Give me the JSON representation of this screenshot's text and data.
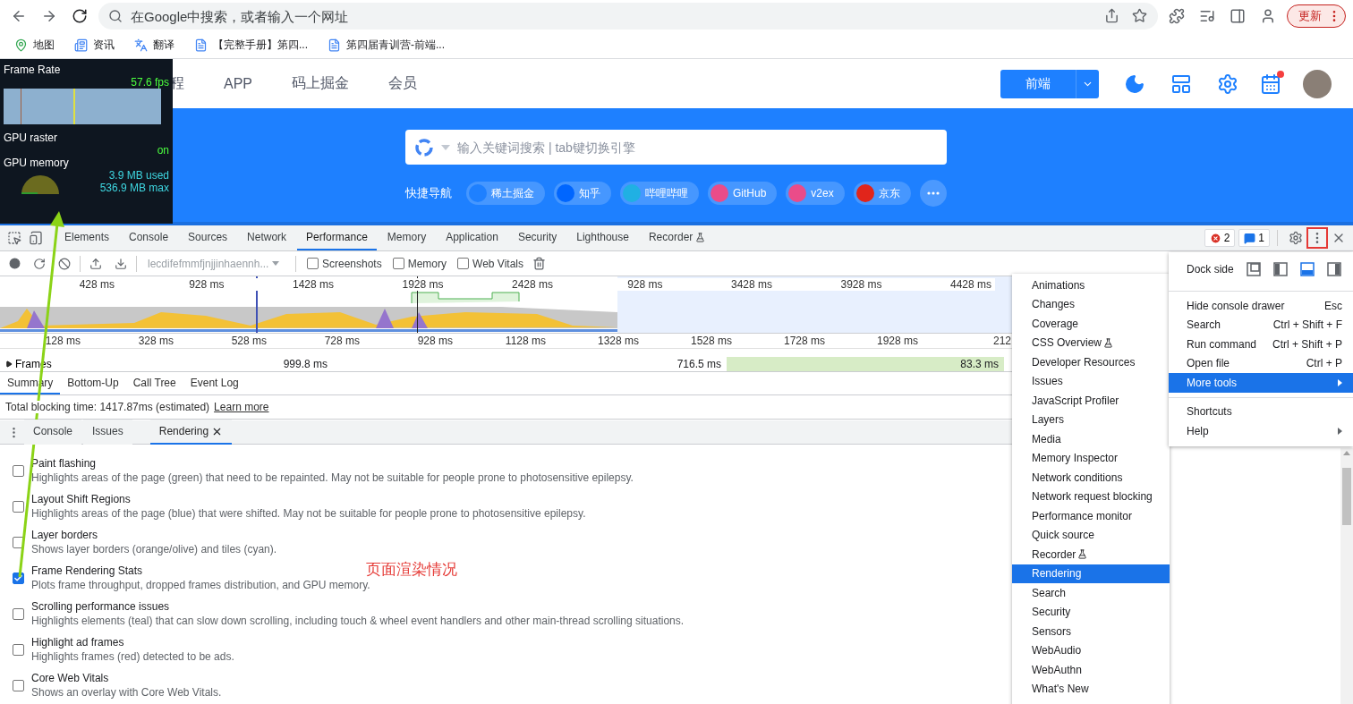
{
  "browser": {
    "address_placeholder": "在Google中搜索，或者输入一个网址",
    "update_button": "更新",
    "bookmarks": [
      {
        "label": "地图",
        "kind": "maps"
      },
      {
        "label": "资讯",
        "kind": "news"
      },
      {
        "label": "翻译",
        "kind": "translate"
      },
      {
        "label": "【完整手册】第四...",
        "kind": "doc"
      },
      {
        "label": "第四届青训营-前端...",
        "kind": "doc"
      }
    ]
  },
  "site": {
    "nav": [
      "程",
      "APP",
      "码上掘金",
      "会员"
    ],
    "category_button": "前端",
    "calendar_notification": true,
    "search_placeholder": "输入关键词搜索 | tab键切换引擎",
    "quick_nav_label": "快捷导航",
    "shortcuts": [
      {
        "label": "稀土掘金",
        "color": "#1e80ff"
      },
      {
        "label": "知乎",
        "color": "#0066ff"
      },
      {
        "label": "哔哩哔哩",
        "color": "#20b0e3"
      },
      {
        "label": "GitHub",
        "color": "#ea4c89"
      },
      {
        "label": "v2ex",
        "color": "#ea4c89"
      },
      {
        "label": "京东",
        "color": "#e1251b"
      }
    ]
  },
  "fps_meter": {
    "title": "Frame Rate",
    "fps": "57.6 fps",
    "raster_label": "GPU raster",
    "raster_value": "on",
    "memory_label": "GPU memory",
    "memory_used": "3.9 MB used",
    "memory_max": "536.9 MB max"
  },
  "devtools": {
    "tabs": [
      {
        "label": "Elements",
        "selected": false,
        "experimental": false
      },
      {
        "label": "Console",
        "selected": false,
        "experimental": false
      },
      {
        "label": "Sources",
        "selected": false,
        "experimental": false
      },
      {
        "label": "Network",
        "selected": false,
        "experimental": false
      },
      {
        "label": "Performance",
        "selected": true,
        "experimental": false
      },
      {
        "label": "Memory",
        "selected": false,
        "experimental": false
      },
      {
        "label": "Application",
        "selected": false,
        "experimental": false
      },
      {
        "label": "Security",
        "selected": false,
        "experimental": false
      },
      {
        "label": "Lighthouse",
        "selected": false,
        "experimental": false
      },
      {
        "label": "Recorder",
        "selected": false,
        "experimental": true
      }
    ],
    "error_count": "2",
    "message_count": "1",
    "menu_button_highlighted": true,
    "profile_select": "lecdifefmmfjnjjinhaennh...",
    "capture_options": [
      {
        "label": "Screenshots",
        "checked": false
      },
      {
        "label": "Memory",
        "checked": false
      },
      {
        "label": "Web Vitals",
        "checked": false
      }
    ],
    "overview_ticks": [
      "428 ms",
      "928 ms",
      "1428 ms",
      "1928 ms",
      "2428 ms",
      "928 ms",
      "3428 ms",
      "3928 ms",
      "4428 ms"
    ],
    "ruler_ticks": [
      "128 ms",
      "328 ms",
      "528 ms",
      "728 ms",
      "928 ms",
      "1128 ms",
      "1328 ms",
      "1528 ms",
      "1728 ms",
      "1928 ms",
      "212"
    ],
    "frames_track": {
      "label": "Frames",
      "expanded": false,
      "durations": [
        "999.8 ms",
        "716.5 ms",
        "83.3 ms"
      ]
    },
    "detail_tabs": [
      {
        "label": "Summary",
        "selected": true
      },
      {
        "label": "Bottom-Up",
        "selected": false
      },
      {
        "label": "Call Tree",
        "selected": false
      },
      {
        "label": "Event Log",
        "selected": false
      }
    ],
    "blocking_time": "Total blocking time: 1417.87ms (estimated)",
    "learn_more": "Learn more",
    "drawer_tabs": [
      {
        "label": "Console",
        "selected": false,
        "closable": false
      },
      {
        "label": "Issues",
        "selected": false,
        "closable": false
      },
      {
        "label": "Rendering",
        "selected": true,
        "closable": true
      }
    ],
    "rendering_options": [
      {
        "title": "Paint flashing",
        "description": "Highlights areas of the page (green) that need to be repainted. May not be suitable for people prone to photosensitive epilepsy.",
        "checked": false
      },
      {
        "title": "Layout Shift Regions",
        "description": "Highlights areas of the page (blue) that were shifted. May not be suitable for people prone to photosensitive epilepsy.",
        "checked": false
      },
      {
        "title": "Layer borders",
        "description": "Shows layer borders (orange/olive) and tiles (cyan).",
        "checked": false
      },
      {
        "title": "Frame Rendering Stats",
        "description": "Plots frame throughput, dropped frames distribution, and GPU memory.",
        "checked": true
      },
      {
        "title": "Scrolling performance issues",
        "description": "Highlights elements (teal) that can slow down scrolling, including touch & wheel event handlers and other main-thread scrolling situations.",
        "checked": false
      },
      {
        "title": "Highlight ad frames",
        "description": "Highlights frames (red) detected to be ads.",
        "checked": false
      },
      {
        "title": "Core Web Vitals",
        "description": "Shows an overlay with Core Web Vitals.",
        "checked": false
      }
    ]
  },
  "annotation": "页面渲染情况",
  "main_menu": {
    "dock_label": "Dock side",
    "dock_options": [
      {
        "selected": false
      },
      {
        "selected": false
      },
      {
        "selected": true
      },
      {
        "selected": false
      }
    ],
    "groups": [
      [
        {
          "label": "Hide console drawer",
          "shortcut": "Esc",
          "selected": false,
          "submenu": false
        },
        {
          "label": "Search",
          "shortcut": "Ctrl + Shift + F",
          "selected": false,
          "submenu": false
        },
        {
          "label": "Run command",
          "shortcut": "Ctrl + Shift + P",
          "selected": false,
          "submenu": false
        },
        {
          "label": "Open file",
          "shortcut": "Ctrl + P",
          "selected": false,
          "submenu": false
        },
        {
          "label": "More tools",
          "selected": true,
          "submenu": true
        }
      ],
      [
        {
          "label": "Shortcuts",
          "selected": false,
          "submenu": false
        },
        {
          "label": "Help",
          "selected": false,
          "submenu": true
        }
      ]
    ]
  },
  "more_tools_menu": [
    {
      "label": "Animations",
      "selected": false,
      "experimental": false
    },
    {
      "label": "Changes",
      "selected": false,
      "experimental": false
    },
    {
      "label": "Coverage",
      "selected": false,
      "experimental": false
    },
    {
      "label": "CSS Overview",
      "selected": false,
      "experimental": true
    },
    {
      "label": "Developer Resources",
      "selected": false,
      "experimental": false
    },
    {
      "label": "Issues",
      "selected": false,
      "experimental": false
    },
    {
      "label": "JavaScript Profiler",
      "selected": false,
      "experimental": false
    },
    {
      "label": "Layers",
      "selected": false,
      "experimental": false
    },
    {
      "label": "Media",
      "selected": false,
      "experimental": false
    },
    {
      "label": "Memory Inspector",
      "selected": false,
      "experimental": false
    },
    {
      "label": "Network conditions",
      "selected": false,
      "experimental": false
    },
    {
      "label": "Network request blocking",
      "selected": false,
      "experimental": false
    },
    {
      "label": "Performance monitor",
      "selected": false,
      "experimental": false
    },
    {
      "label": "Quick source",
      "selected": false,
      "experimental": false
    },
    {
      "label": "Recorder",
      "selected": false,
      "experimental": true
    },
    {
      "label": "Rendering",
      "selected": true,
      "experimental": false
    },
    {
      "label": "Search",
      "selected": false,
      "experimental": false
    },
    {
      "label": "Security",
      "selected": false,
      "experimental": false
    },
    {
      "label": "Sensors",
      "selected": false,
      "experimental": false
    },
    {
      "label": "WebAudio",
      "selected": false,
      "experimental": false
    },
    {
      "label": "WebAuthn",
      "selected": false,
      "experimental": false
    },
    {
      "label": "What's New",
      "selected": false,
      "experimental": false
    }
  ]
}
